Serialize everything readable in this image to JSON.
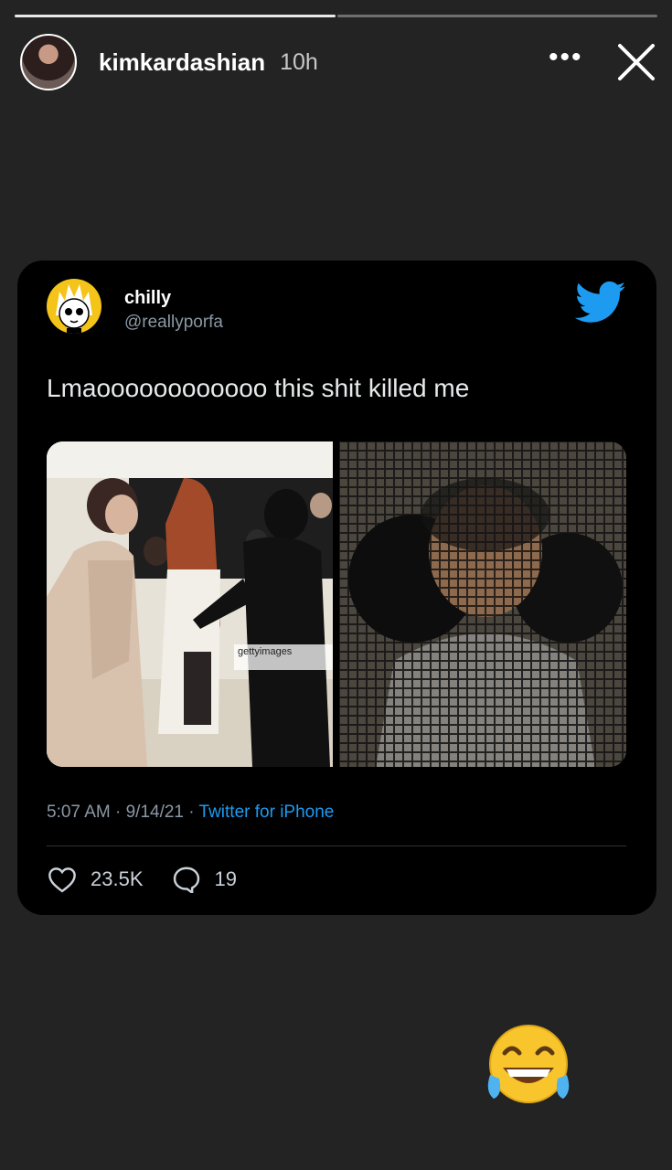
{
  "story": {
    "username": "kimkardashian",
    "time": "10h",
    "more_label": "•••",
    "progress": {
      "segments": 2,
      "completed": 1
    }
  },
  "tweet": {
    "display_name": "chilly",
    "handle": "@reallyporfa",
    "text": "Lmaoooooooooooo this shit killed me",
    "watermark": "gettyimages",
    "timestamp": "5:07 AM · 9/14/21 · ",
    "source": "Twitter for iPhone",
    "likes": "23.5K",
    "replies": "19"
  },
  "colors": {
    "accent": "#1d9bf0",
    "background": "#232323",
    "card": "#000000"
  },
  "icons": [
    "more-icon",
    "close-icon",
    "twitter-bird-icon",
    "heart-icon",
    "reply-icon",
    "laughing-emoji-icon"
  ]
}
